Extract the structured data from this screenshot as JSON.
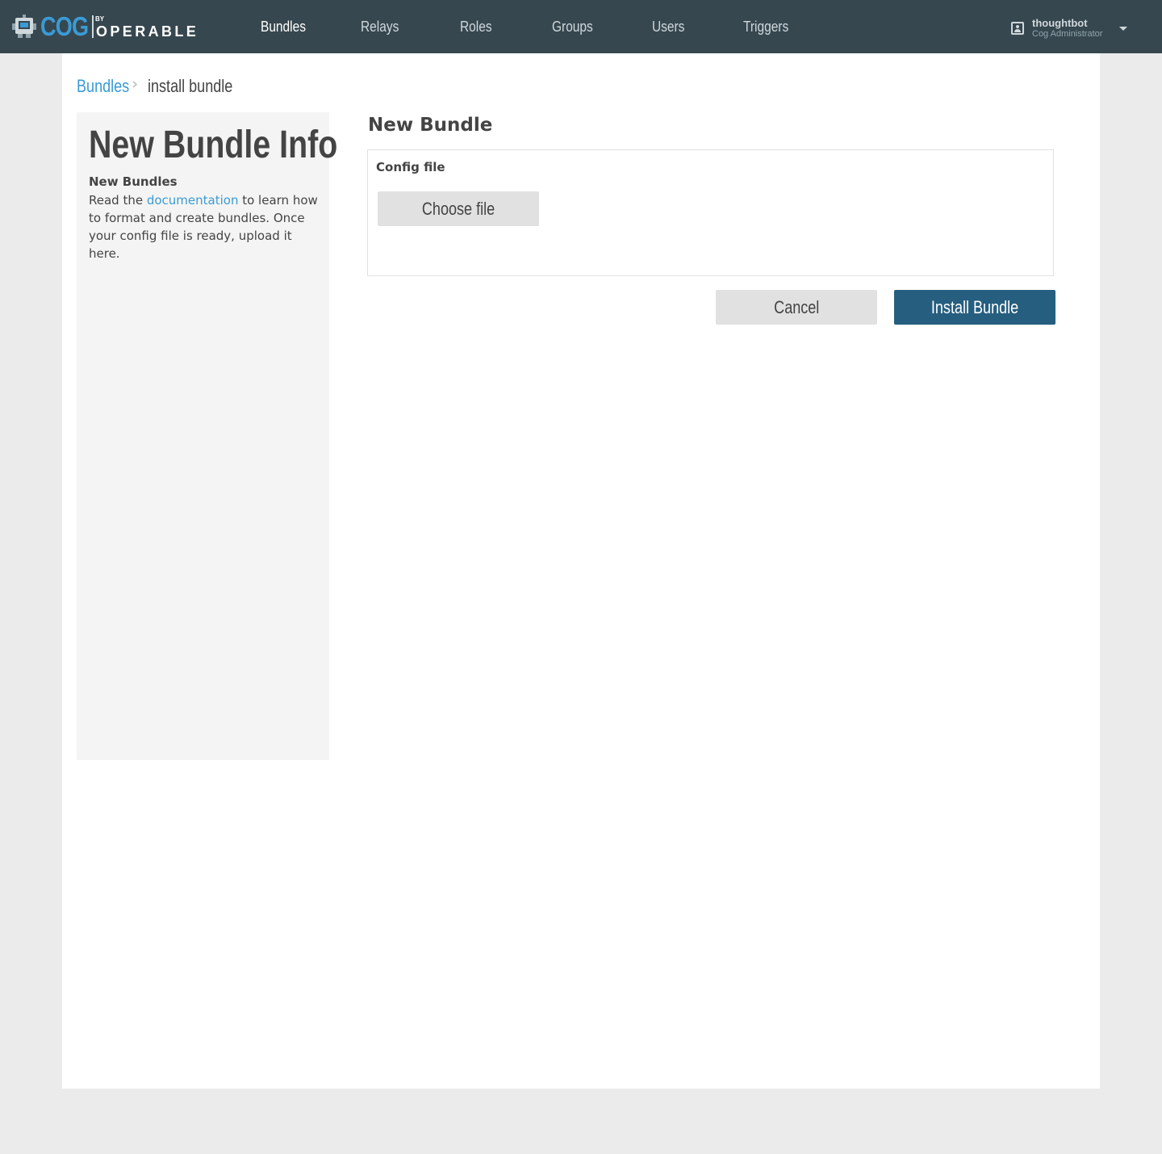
{
  "brand": {
    "name": "COG",
    "by": "BY",
    "company": "OPERABLE"
  },
  "nav": {
    "items": [
      {
        "label": "Bundles",
        "active": true
      },
      {
        "label": "Relays",
        "active": false
      },
      {
        "label": "Roles",
        "active": false
      },
      {
        "label": "Groups",
        "active": false
      },
      {
        "label": "Users",
        "active": false
      },
      {
        "label": "Triggers",
        "active": false
      }
    ]
  },
  "user": {
    "name": "thoughtbot",
    "role": "Cog Administrator"
  },
  "breadcrumb": {
    "parent": "Bundles",
    "current": "install bundle"
  },
  "sidebar": {
    "title": "New Bundle Info",
    "subtitle": "New Bundles",
    "text_before": "Read the ",
    "link": "documentation",
    "text_after": " to learn how to format and create bundles. Once your config file is ready, upload it here."
  },
  "form": {
    "title": "New Bundle",
    "field_label": "Config file",
    "file_button": "Choose file",
    "cancel_button": "Cancel",
    "submit_button": "Install Bundle"
  },
  "colors": {
    "topbar": "#37474f",
    "accent": "#3a9bd5",
    "primary_button": "#265e7f",
    "secondary_button": "#e1e1e1",
    "page_background": "#ebebeb",
    "panel_background": "#f4f4f4"
  }
}
